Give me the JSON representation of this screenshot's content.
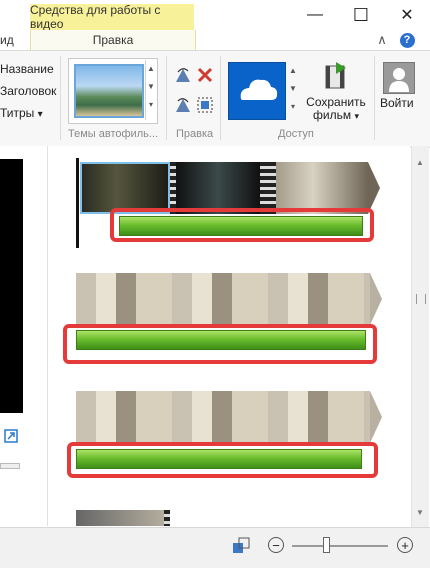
{
  "tabs": {
    "partial_tab": "ид",
    "context_title": "Средства для работы с видео",
    "context_tab": "Правка"
  },
  "window": {
    "minimize_glyph": "—",
    "maximize_glyph": "☐",
    "close_glyph": "✕",
    "collapse_glyph": "∧",
    "help_glyph": "?"
  },
  "ribbon": {
    "text_items": [
      "Название",
      "Заголовок",
      "Титры"
    ],
    "titles_dropdown_glyph": "▾",
    "theme_group_label": "Темы автофиль...",
    "edit_group_label": "Правка",
    "share_group_label": "Доступ",
    "save_movie_label_1": "Сохранить",
    "save_movie_label_2": "фильм",
    "signin_label": "Войти"
  },
  "storyboard": {
    "track_count": 4
  },
  "status": {
    "zoom_minus": "−",
    "zoom_plus": "+",
    "zoom_level": 0.35
  },
  "colors": {
    "context_tab": "#f7f19a",
    "highlight_box": "#e53a3a",
    "audio_wave": "#6bbd2d",
    "onedrive": "#0a63c9"
  }
}
